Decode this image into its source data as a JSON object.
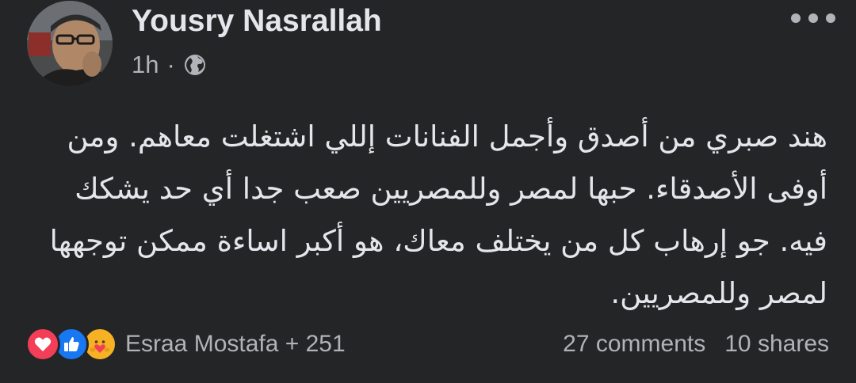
{
  "post": {
    "author": "Yousry Nasrallah",
    "time": "1h",
    "separator": "·",
    "audience_icon": "globe-icon",
    "text": "هند صبري من أصدق وأجمل الفنانات إللي اشتغلت معاهم. ومن أوفى الأصدقاء. حبها لمصر وللمصريين صعب جدا أي حد يشكك فيه. جو إرهاب كل من يختلف معاك، هو أكبر اساءة ممكن توجهها لمصر وللمصريين.",
    "more_icon": "more-options-icon"
  },
  "reactions": {
    "icons": [
      "love-reaction-icon",
      "like-reaction-icon",
      "care-reaction-icon"
    ],
    "summary": "Esraa Mostafa + 251"
  },
  "counts": {
    "comments": "27 comments",
    "shares": "10 shares"
  },
  "colors": {
    "background": "#242526",
    "primary_text": "#e4e6eb",
    "secondary_text": "#b0b3b8",
    "love": "#f33e58",
    "like": "#1877f2",
    "care": "#f7b125"
  }
}
